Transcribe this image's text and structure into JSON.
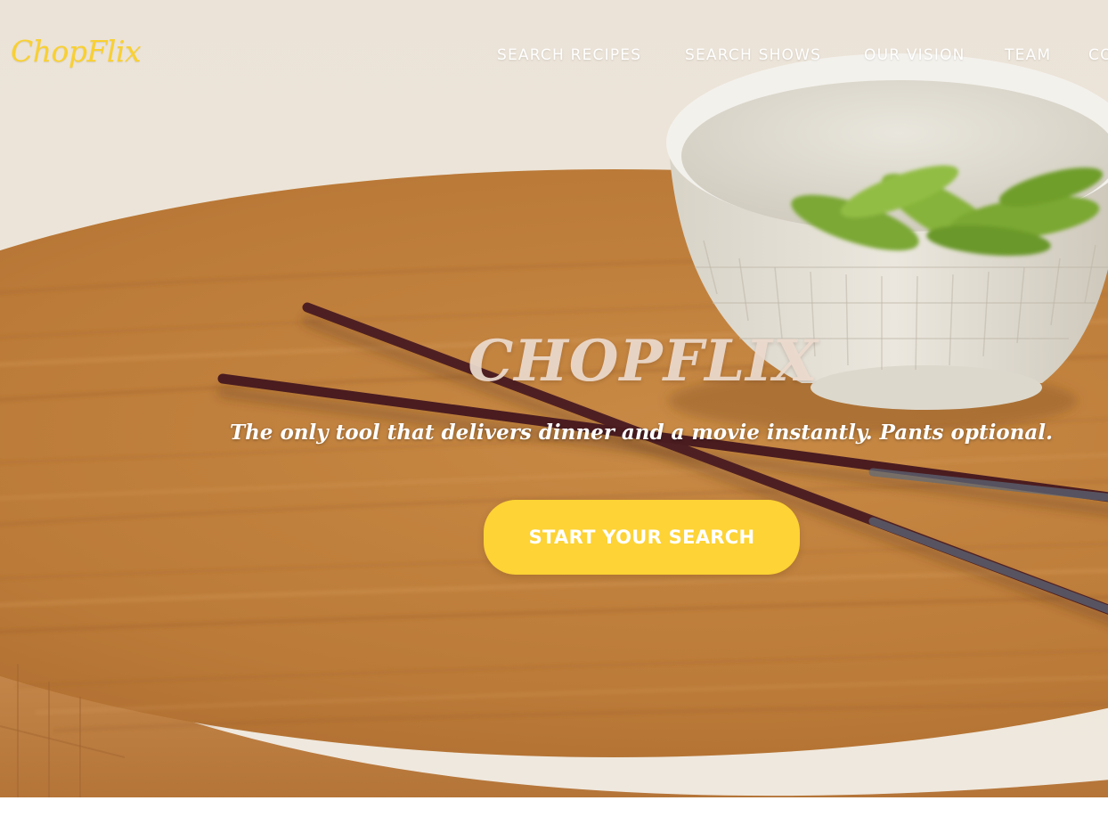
{
  "brand": {
    "logo_text": "ChopFlix",
    "accent_color": "#fdd335"
  },
  "nav": {
    "items": [
      {
        "label": "SEARCH RECIPES"
      },
      {
        "label": "SEARCH SHOWS"
      },
      {
        "label": "OUR VISION"
      },
      {
        "label": "TEAM"
      },
      {
        "label": "CONTACT"
      }
    ]
  },
  "hero": {
    "title": "CHOPFLIX",
    "tagline": "The only tool that delivers dinner and a movie instantly. Pants optional.",
    "cta_label": "START YOUR SEARCH",
    "background_image": "wooden-board-chopsticks-edamame-bowl"
  }
}
